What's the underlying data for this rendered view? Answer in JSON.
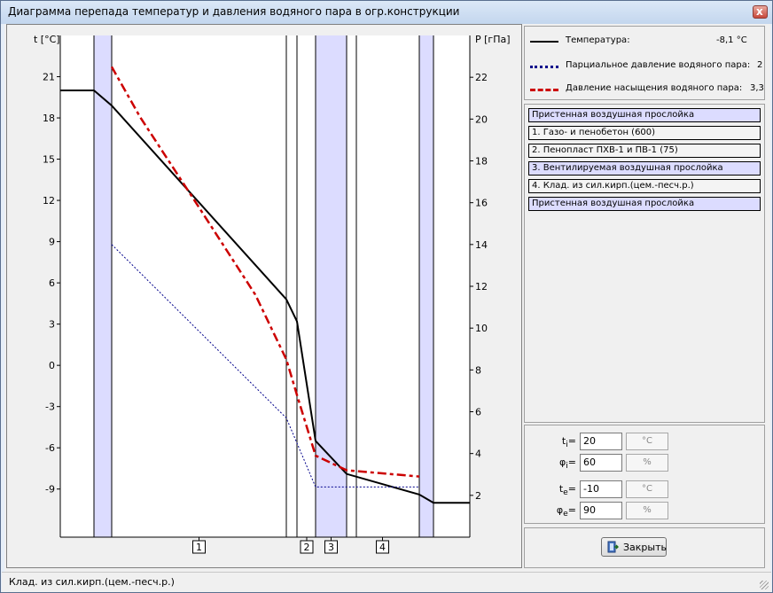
{
  "window": {
    "title": "Диаграмма перепада температур и давления водяного пара в огр.конструкции",
    "close_glyph": "x"
  },
  "chart_data": {
    "type": "line",
    "left_axis_label": "t [°C]",
    "right_axis_label": "P [гПа]",
    "left_ylim": [
      -12.5,
      24
    ],
    "right_ylim": [
      0,
      24
    ],
    "left_ticks": [
      21,
      18,
      15,
      12,
      9,
      6,
      3,
      0,
      -3,
      -6,
      -9
    ],
    "right_ticks": [
      22,
      20,
      18,
      16,
      14,
      12,
      10,
      8,
      6,
      4,
      2
    ],
    "grid": false,
    "layer_labels": [
      "1",
      "2",
      "3",
      "4"
    ],
    "series": [
      {
        "name": "Температура",
        "axis": "left",
        "color": "#000000",
        "style": "solid",
        "x": [
          0,
          38,
          58,
          255,
          267,
          288,
          323,
          405,
          421,
          462
        ],
        "y": [
          20,
          20,
          18.9,
          4.8,
          3.2,
          -5.5,
          -7.9,
          -9.4,
          -10,
          -10
        ]
      },
      {
        "name": "Парциальное давление водяного пара",
        "axis": "right",
        "color": "#00008b",
        "style": "dotted",
        "x": [
          58,
          255,
          288,
          405
        ],
        "y": [
          14,
          5.7,
          2.4,
          2.4
        ]
      },
      {
        "name": "Давление насыщения водяного пара",
        "axis": "right",
        "color": "#cc0000",
        "style": "dashed",
        "x": [
          58,
          90,
          150,
          220,
          255,
          267,
          288,
          323,
          405
        ],
        "y": [
          22.5,
          20.1,
          16.2,
          11.6,
          8.5,
          6.8,
          3.9,
          3.2,
          2.9
        ]
      }
    ]
  },
  "legend": {
    "items": [
      {
        "label": "Температура:",
        "value": "-8,1 °C",
        "color": "#000000"
      },
      {
        "label": "Парциальное давление водяного пара:",
        "value": "2",
        "color": "#00008b"
      },
      {
        "label": "Давление насыщения водяного пара:",
        "value": "3,3",
        "color": "#cc0000"
      }
    ]
  },
  "layers": {
    "items": [
      {
        "label": "Пристенная воздушная прослойка",
        "kind": "air"
      },
      {
        "label": "1. Газо- и пенобетон (600)",
        "kind": "solid"
      },
      {
        "label": "2. Пенопласт ПХВ-1 и ПВ-1 (75)",
        "kind": "solid"
      },
      {
        "label": "3. Вентилируемая воздушная прослойка",
        "kind": "air"
      },
      {
        "label": "4. Клад. из сил.кирп.(цем.-песч.р.)",
        "kind": "solid"
      },
      {
        "label": "Пристенная воздушная прослойка",
        "kind": "air"
      }
    ]
  },
  "params": {
    "ti": {
      "label_main": "t",
      "label_sub": "i",
      "value": "20",
      "unit": "°C"
    },
    "phii": {
      "label_main": "φ",
      "label_sub": "i",
      "value": "60",
      "unit": "%"
    },
    "te": {
      "label_main": "t",
      "label_sub": "e",
      "value": "-10",
      "unit": "°C"
    },
    "phie": {
      "label_main": "φ",
      "label_sub": "e",
      "value": "90",
      "unit": "%"
    }
  },
  "close_button": {
    "label": "Закрыть"
  },
  "status": {
    "text": "Клад. из сил.кирп.(цем.-песч.р.)"
  },
  "colors": {
    "air_layer": "#dcdcff",
    "accent": "#3366cc"
  }
}
